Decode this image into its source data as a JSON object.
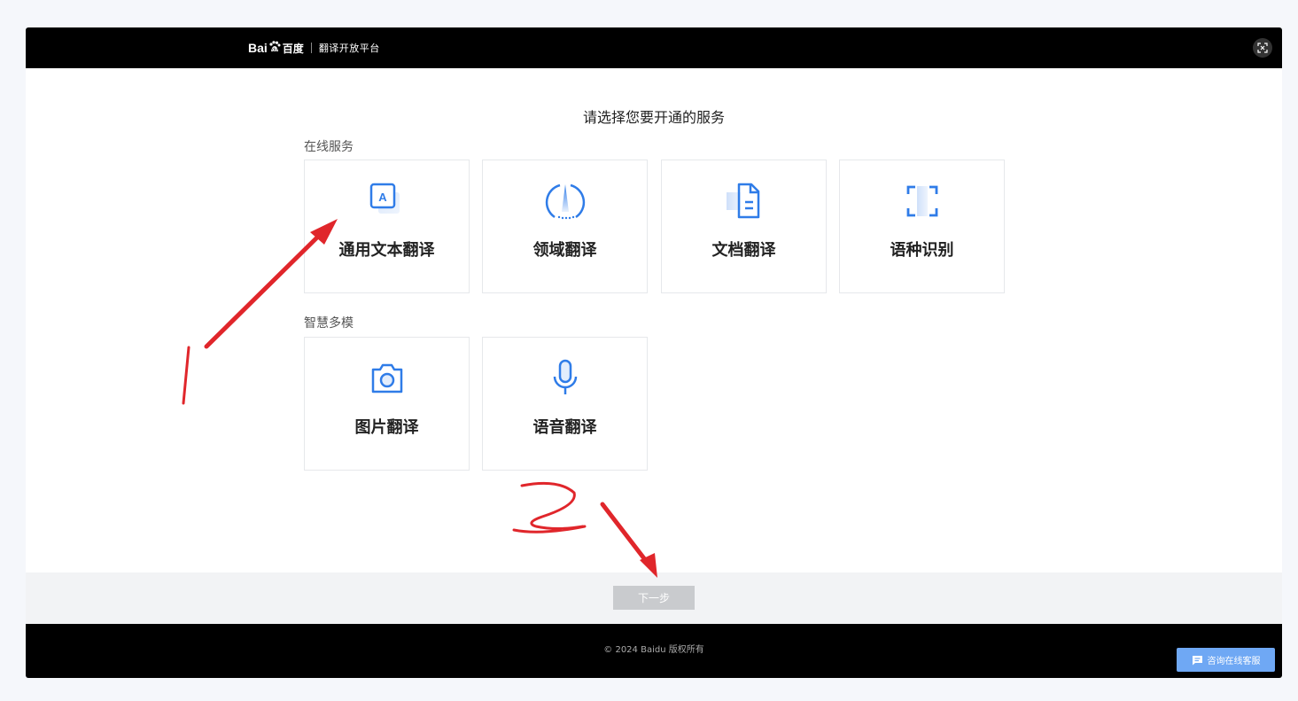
{
  "header": {
    "logo_bai": "Bai",
    "logo_du": "",
    "logo_cn": "百度",
    "separator": "|",
    "subtitle": "翻译开放平台"
  },
  "main": {
    "title": "请选择您要开通的服务",
    "sections": [
      {
        "label": "在线服务",
        "cards": [
          {
            "label": "通用文本翻译",
            "icon": "text-translate-icon"
          },
          {
            "label": "领域翻译",
            "icon": "domain-compass-icon"
          },
          {
            "label": "文档翻译",
            "icon": "document-icon"
          },
          {
            "label": "语种识别",
            "icon": "scan-frame-icon"
          }
        ]
      },
      {
        "label": "智慧多模",
        "cards": [
          {
            "label": "图片翻译",
            "icon": "camera-icon"
          },
          {
            "label": "语音翻译",
            "icon": "microphone-icon"
          }
        ]
      }
    ]
  },
  "footer": {
    "next_label": "下一步",
    "copyright": "© 2024 Baidu 版权所有"
  },
  "consult": {
    "label": "咨询在线客服"
  },
  "colors": {
    "accent": "#2f7ce8",
    "annotation": "#e0262b",
    "button_disabled": "#c9cbce",
    "consult": "#6fa8f4"
  }
}
